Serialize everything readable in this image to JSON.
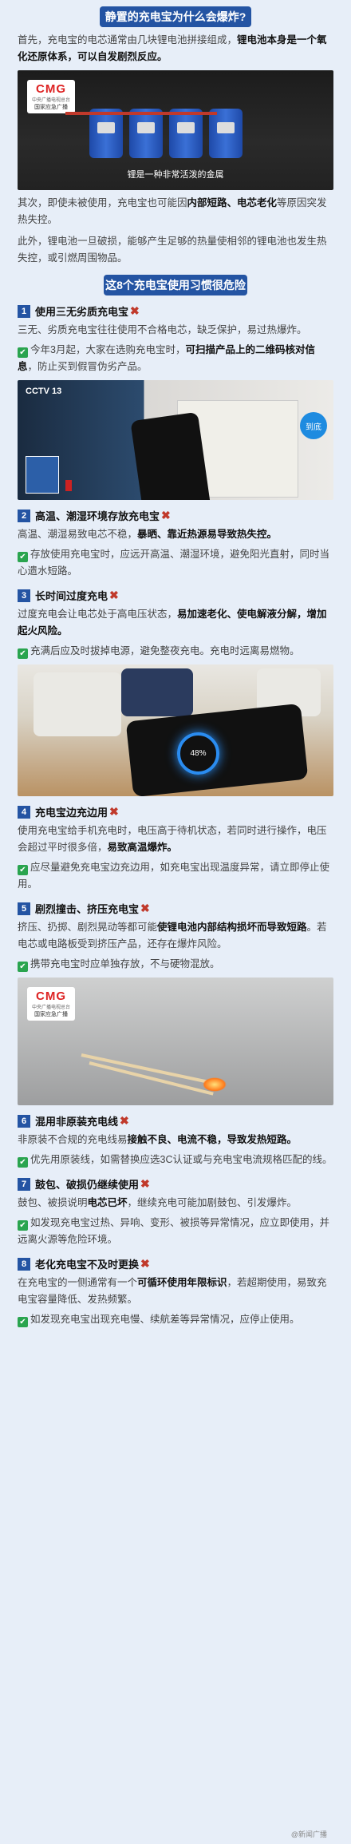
{
  "section1": {
    "banner": "静置的充电宝为什么会爆炸?",
    "intro_a": "首先，充电宝的电芯通常由几块锂电池拼接组成，",
    "intro_b": "锂电池本身是一个氧化还原体系，可以自发剧烈反应。",
    "image_caption": "锂是一种非常活泼的金属",
    "logo": "CMG",
    "logo_sub": "中央广播电视总台",
    "logo_org": "国家应急广播",
    "para2_a": "其次，即使未被使用，充电宝也可能因",
    "para2_b": "内部短路、电芯老化",
    "para2_c": "等原因突发热失控。",
    "para3": "此外，锂电池一旦破损，能够产生足够的热量使相邻的锂电池也发生热失控，或引燃周围物品。"
  },
  "section2": {
    "title": "这8个充电宝使用习惯很危险"
  },
  "items": [
    {
      "num": "1",
      "title": "使用三无劣质充电宝",
      "desc": "三无、劣质充电宝往往使用不合格电芯，缺乏保护，易过热爆炸。",
      "tip_a": "今年3月起，大家在选购充电宝时，",
      "tip_b": "可扫描产品上的二维码核对信息",
      "tip_c": "，防止买到假冒伪劣产品。"
    },
    {
      "num": "2",
      "title": "高温、潮湿环境存放充电宝",
      "desc_a": "高温、潮湿易致电芯不稳，",
      "desc_b": "暴晒、靠近热源易导致热失控。",
      "tip": "存放使用充电宝时，应远开高温、潮湿环境，避免阳光直射，同时当心遗水短路。"
    },
    {
      "num": "3",
      "title": "长时间过度充电",
      "desc_a": "过度充电会让电芯处于高电压状态，",
      "desc_b": "易加速老化、使电解液分解，增加起火风险。",
      "tip": "充满后应及时拔掉电源，避免整夜充电。充电时远离易燃物。"
    },
    {
      "num": "4",
      "title": "充电宝边充边用",
      "desc_a": "使用充电宝给手机充电时，电压高于待机状态，若同时进行操作，电压会超过平时很多倍，",
      "desc_b": "易致高温爆炸。",
      "tip": "应尽量避免充电宝边充边用，如充电宝出现温度异常，请立即停止使用。"
    },
    {
      "num": "5",
      "title": "剧烈撞击、挤压充电宝",
      "desc_a": "挤压、扔掷、剧烈晃动等都可能",
      "desc_b": "使锂电池内部结构损坏而导致短路",
      "desc_c": "。若电芯或电路板受到挤压产品，还存在爆炸风险。",
      "tip": "携带充电宝时应单独存放，不与硬物混放。"
    },
    {
      "num": "6",
      "title": "混用非原装充电线",
      "desc_a": "非原装不合规的充电线易",
      "desc_b": "接触不良、电流不稳，导致发热短路。",
      "tip": "优先用原装线，如需替换应选3C认证或与充电宝电流规格匹配的线。"
    },
    {
      "num": "7",
      "title": "鼓包、破损仍继续使用",
      "desc_a": "鼓包、被损说明",
      "desc_b": "电芯已坏",
      "desc_c": "，继续充电可能加剧鼓包、引发爆炸。",
      "tip": "如发现充电宝过热、异响、变形、被损等异常情况，应立即使用，并远离火源等危险环境。"
    },
    {
      "num": "8",
      "title": "老化充电宝不及时更换",
      "desc_a": "在充电宝的一侧通常有一个",
      "desc_b": "可循环使用年限标识",
      "desc_c": "，若超期使用，易致充电宝容量降低、发热频繁。",
      "tip": "如发现充电宝出现充电慢、续航差等异常情况，应停止使用。"
    }
  ],
  "img2": {
    "channel": "CCTV 13",
    "corner": "到底"
  },
  "img3": {
    "phone_percent": "48%"
  },
  "watermark": "@新闻广播"
}
